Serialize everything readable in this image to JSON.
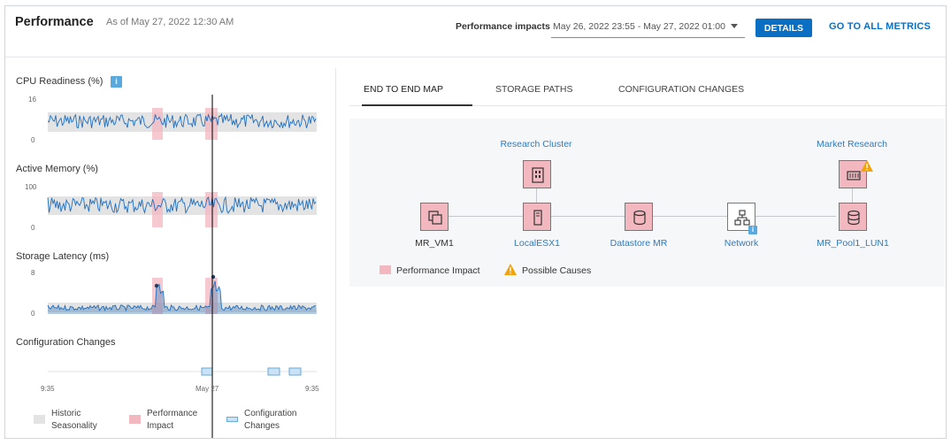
{
  "header": {
    "title": "Performance",
    "as_of": "As of May 27, 2022 12:30 AM",
    "performance_impacts_label": "Performance impacts",
    "performance_impacts_value": "May 26, 2022 23:55 - May 27, 2022 01:00",
    "details_label": "DETAILS",
    "go_to_all_metrics_label": "GO TO ALL METRICS"
  },
  "metrics": [
    {
      "label": "CPU Readiness (%)",
      "y_top": "16",
      "y_bottom": "0",
      "has_info": true
    },
    {
      "label": "Active Memory (%)",
      "y_top": "100",
      "y_bottom": "0",
      "has_info": false
    },
    {
      "label": "Storage Latency (ms)",
      "y_top": "8",
      "y_bottom": "0",
      "has_info": false
    }
  ],
  "info_icon_glyph": "i",
  "config_changes": {
    "label": "Configuration Changes",
    "x_ticks": [
      "9:35",
      "May 27",
      "9:35"
    ]
  },
  "legend": [
    {
      "label_line1": "Historic",
      "label_line2": "Seasonality",
      "color": "#e3e3e3"
    },
    {
      "label_line1": "Performance",
      "label_line2": "Impact",
      "color": "#f2b7bf"
    },
    {
      "label_line1": "Configuration",
      "label_line2": "Changes",
      "color": "#c9e2f5"
    }
  ],
  "tabs": [
    {
      "label": "END TO END MAP",
      "active": true
    },
    {
      "label": "STORAGE PATHS",
      "active": false
    },
    {
      "label": "CONFIGURATION CHANGES",
      "active": false
    }
  ],
  "map": {
    "top_nodes": [
      {
        "label": "Research Cluster",
        "icon": "cluster-icon"
      },
      {
        "label": "Market Research",
        "icon": "datacenter-icon",
        "warning": true
      }
    ],
    "nodes": [
      {
        "label": "MR_VM1",
        "icon": "vm-icon",
        "impact": true,
        "label_color": "dark"
      },
      {
        "label": "LocalESX1",
        "icon": "host-icon",
        "impact": true,
        "label_color": "link"
      },
      {
        "label": "Datastore MR",
        "icon": "datastore-icon",
        "impact": true,
        "label_color": "link"
      },
      {
        "label": "Network",
        "icon": "network-icon",
        "impact": false,
        "label_color": "link"
      },
      {
        "label": "MR_Pool1_LUN1",
        "icon": "lun-icon",
        "impact": true,
        "label_color": "link"
      }
    ],
    "legend": {
      "performance_impact": "Performance Impact",
      "possible_causes": "Possible Causes"
    }
  },
  "colors": {
    "accent": "#0a6fc2",
    "impact_pink": "#f2b7bf",
    "seasonality_gray": "#e3e3e3",
    "series_blue": "#1f6fbf",
    "warning": "#f0a30a"
  }
}
